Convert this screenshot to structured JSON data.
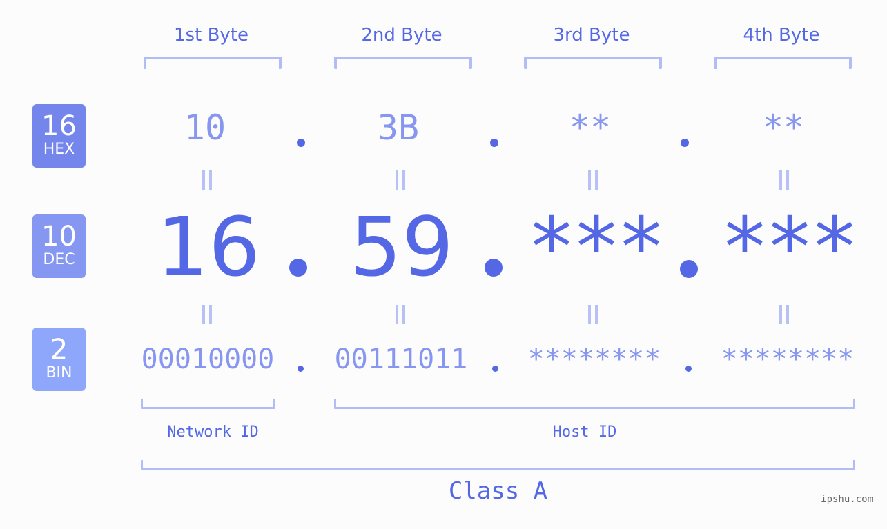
{
  "bytes": {
    "labels": [
      "1st Byte",
      "2nd Byte",
      "3rd Byte",
      "4th Byte"
    ]
  },
  "badges": {
    "hex": {
      "base": "16",
      "name": "HEX"
    },
    "dec": {
      "base": "10",
      "name": "DEC"
    },
    "bin": {
      "base": "2",
      "name": "BIN"
    }
  },
  "ip": {
    "hex": [
      "10",
      "3B",
      "**",
      "**"
    ],
    "dec": [
      "16",
      "59",
      "***",
      "***"
    ],
    "bin": [
      "00010000",
      "00111011",
      "********",
      "********"
    ]
  },
  "segments": {
    "network_label": "Network ID",
    "host_label": "Host ID",
    "class_label": "Class A"
  },
  "colors": {
    "accent": "#5468e6",
    "light_value": "#8796f0",
    "bracket": "#b2bcf6",
    "hex_badge": "#7485eb",
    "dec_badge": "#8597f0",
    "bin_badge": "#8ea7fa"
  },
  "watermark": "ipshu.com"
}
